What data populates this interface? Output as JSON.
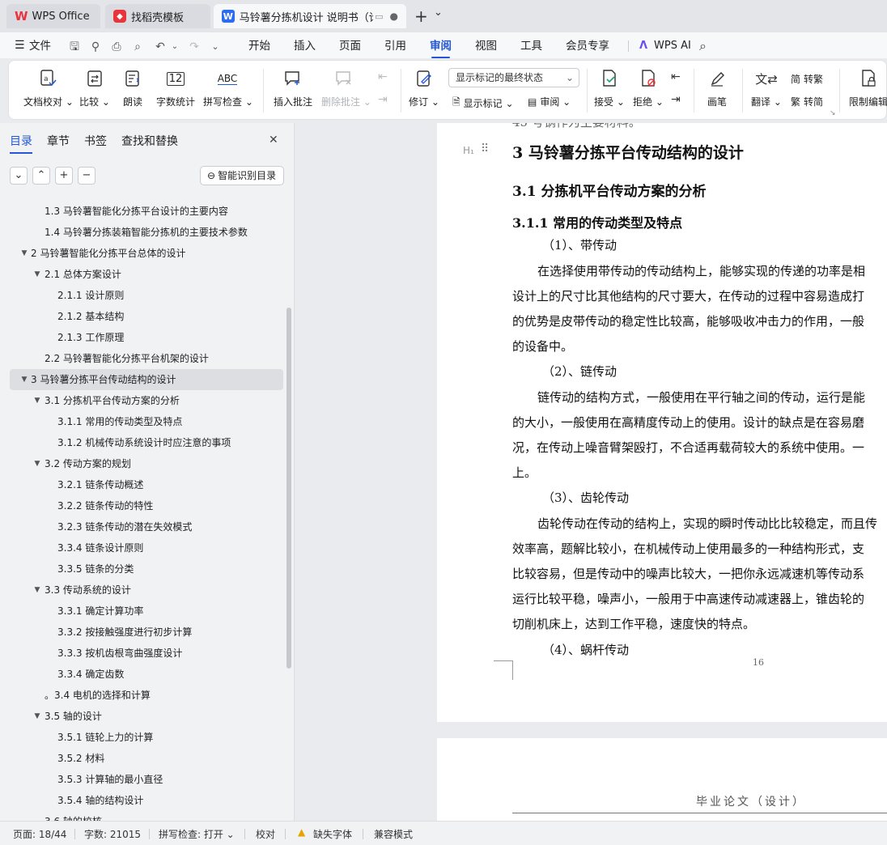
{
  "titlebar": {
    "tabs": [
      {
        "label": "WPS Office"
      },
      {
        "label": "找稻壳模板"
      },
      {
        "label": "马铃薯分拣机设计 说明书（论"
      }
    ],
    "new_tab": "+",
    "new_tab_arrow": "⌄"
  },
  "menubar": {
    "file": "文件",
    "items": [
      "开始",
      "插入",
      "页面",
      "引用",
      "审阅",
      "视图",
      "工具",
      "会员专享"
    ],
    "active": "审阅",
    "wps_ai": "WPS AI"
  },
  "ribbon": {
    "doc_check": "文档校对",
    "compare": "比较",
    "read_aloud": "朗读",
    "word_count": "字数统计",
    "word_count_icon_text": "12",
    "spell_check": "拼写检查",
    "spell_icon_text": "ABC",
    "insert_comment": "插入批注",
    "delete_comment": "删除批注",
    "revise": "修订",
    "show_state": "显示标记的最终状态",
    "show_markup": "显示标记",
    "review": "审阅",
    "accept": "接受",
    "reject": "拒绝",
    "pen": "画笔",
    "translate": "翻译",
    "to_traditional": "转繁",
    "to_simplified": "转简",
    "restrict_edit": "限制编辑"
  },
  "navpane": {
    "tabs": [
      "目录",
      "章节",
      "书签",
      "查找和替换"
    ],
    "active_tab": "目录",
    "close": "✕",
    "buttons": [
      "⌄",
      "⌃",
      "+",
      "−"
    ],
    "smart_toc": "智能识别目录",
    "toc": [
      {
        "text": "1.3  马铃薯智能化分拣平台设计的主要内容",
        "level": 2,
        "toggle": ""
      },
      {
        "text": "1.4  马铃薯分拣装箱智能分拣机的主要技术参数",
        "level": 2,
        "toggle": ""
      },
      {
        "text": "2  马铃薯智能化分拣平台总体的设计",
        "level": 1,
        "toggle": "▼"
      },
      {
        "text": "2.1  总体方案设计",
        "level": 2,
        "toggle": "▼"
      },
      {
        "text": "2.1.1  设计原则",
        "level": 3,
        "toggle": ""
      },
      {
        "text": "2.1.2  基本结构",
        "level": 3,
        "toggle": ""
      },
      {
        "text": "2.1.3  工作原理",
        "level": 3,
        "toggle": ""
      },
      {
        "text": "2.2 马铃薯智能化分拣平台机架的设计",
        "level": 2,
        "toggle": ""
      },
      {
        "text": "3  马铃薯分拣平台传动结构的设计",
        "level": 1,
        "toggle": "▼",
        "selected": true
      },
      {
        "text": "3.1 分拣机平台传动方案的分析",
        "level": 2,
        "toggle": "▼"
      },
      {
        "text": "3.1.1 常用的传动类型及特点",
        "level": 3,
        "toggle": ""
      },
      {
        "text": "3.1.2 机械传动系统设计时应注意的事项",
        "level": 3,
        "toggle": ""
      },
      {
        "text": "3.2  传动方案的规划",
        "level": 2,
        "toggle": "▼"
      },
      {
        "text": "3.2.1  链条传动概述",
        "level": 3,
        "toggle": ""
      },
      {
        "text": "3.2.2  链条传动的特性",
        "level": 3,
        "toggle": ""
      },
      {
        "text": "3.2.3  链条传动的潜在失效模式",
        "level": 3,
        "toggle": ""
      },
      {
        "text": "3.3.4  链条设计原则",
        "level": 3,
        "toggle": ""
      },
      {
        "text": "3.3.5  链条的分类",
        "level": 3,
        "toggle": ""
      },
      {
        "text": "3.3 传动系统的设计",
        "level": 2,
        "toggle": "▼"
      },
      {
        "text": "3.3.1 确定计算功率",
        "level": 3,
        "toggle": ""
      },
      {
        "text": "3.3.2 按接触强度进行初步计算",
        "level": 3,
        "toggle": ""
      },
      {
        "text": "3.3.3 按机齿根弯曲强度设计",
        "level": 3,
        "toggle": ""
      },
      {
        "text": "3.3.4 确定齿数",
        "level": 3,
        "toggle": ""
      },
      {
        "text": "。3.4 电机的选择和计算",
        "level": 2,
        "toggle": ""
      },
      {
        "text": "3.5 轴的设计",
        "level": 2,
        "toggle": "▼"
      },
      {
        "text": "3.5.1 链轮上力的计算",
        "level": 3,
        "toggle": ""
      },
      {
        "text": "3.5.2 材料",
        "level": 3,
        "toggle": ""
      },
      {
        "text": "3.5.3 计算轴的最小直径",
        "level": 3,
        "toggle": ""
      },
      {
        "text": "3.5.4 轴的结构设计",
        "level": 3,
        "toggle": ""
      },
      {
        "text": "3.6 轴的校核",
        "level": 2,
        "toggle": ""
      }
    ]
  },
  "document": {
    "top_partial": "45 号钢作为主要材料。",
    "heading_marker": "H₁",
    "h1": "3  马铃薯分拣平台传动结构的设计",
    "h2": "3.1 分拣机平台传动方案的分析",
    "h3": "3.1.1 常用的传动类型及特点",
    "lines": [
      "（1）、带传动",
      "在选择使用带传动的传动结构上，能够实现的传递的功率是相",
      "设计上的尺寸比其他结构的尺寸要大，在传动的过程中容易造成打",
      "的优势是皮带传动的稳定性比较高，能够吸收冲击力的作用，一般",
      "的设备中。",
      "（2）、链传动",
      "链传动的结构方式，一般使用在平行轴之间的传动，运行是能",
      "的大小，一般使用在高精度传动上的使用。设计的缺点是在容易磨",
      "况，在传动上噪音臂架殴打，不合适再载荷较大的系统中使用。一",
      "上。",
      "（3）、齿轮传动",
      "齿轮传动在传动的结构上，实现的瞬时传动比比较稳定，而且传",
      "效率高，题解比较小，在机械传动上使用最多的一种结构形式，支",
      "比较容易，但是传动中的噪声比较大，一把你永远减速机等传动系",
      "运行比较平稳，噪声小，一般用于中高速传动减速器上，锥齿轮的",
      "切削机床上，达到工作平稳，速度快的特点。",
      "（4）、蜗杆传动"
    ],
    "page_number": "16",
    "next_page_header": "毕业论文（设计）"
  },
  "statusbar": {
    "page": "页面: 18/44",
    "words": "字数: 21015",
    "spell": "拼写检查: 打开",
    "proof": "校对",
    "missing_font": "缺失字体",
    "compat": "兼容模式"
  }
}
